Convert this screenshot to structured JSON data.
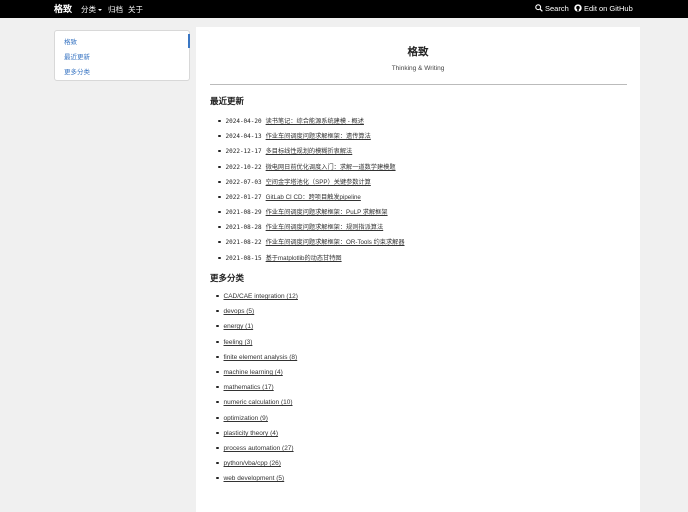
{
  "navbar": {
    "brand": "格致",
    "items": [
      "分类",
      "归档",
      "关于"
    ],
    "search": "Search",
    "github": "Edit on GitHub"
  },
  "sidebar": {
    "items": [
      "格致",
      "最近更新",
      "更多分类"
    ]
  },
  "header": {
    "title": "格致",
    "subtitle": "Thinking & Writing"
  },
  "recent": {
    "heading": "最近更新",
    "posts": [
      {
        "date": "2024-04-20",
        "title": "读书笔记：综合能源系统建模 - 概述"
      },
      {
        "date": "2024-04-13",
        "title": "作业车间调度问题求解框架：遗传算法"
      },
      {
        "date": "2022-12-17",
        "title": "多目标线性规划的模糊折衷解法"
      },
      {
        "date": "2022-10-22",
        "title": "微电网日前优化调度入门：求解一道数学建模题"
      },
      {
        "date": "2022-07-03",
        "title": "空间金字塔池化（SPP）关键参数计算"
      },
      {
        "date": "2022-01-27",
        "title": "GitLab CI CD：跨项目触发pipeline"
      },
      {
        "date": "2021-08-29",
        "title": "作业车间调度问题求解框架：PuLP 求解框架"
      },
      {
        "date": "2021-08-28",
        "title": "作业车间调度问题求解框架：规则指派算法"
      },
      {
        "date": "2021-08-22",
        "title": "作业车间调度问题求解框架：OR-Tools 约束求解器"
      },
      {
        "date": "2021-08-15",
        "title": "基于matplotlib的动态甘特图"
      }
    ]
  },
  "categories": {
    "heading": "更多分类",
    "items": [
      "CAD/CAE integration (12)",
      "devops (5)",
      "energy (1)",
      "feeling (3)",
      "finite element analysis (8)",
      "machine learning (4)",
      "mathematics (17)",
      "numeric calculation (10)",
      "optimization (9)",
      "plasticity theory (4)",
      "process automation (27)",
      "python/vba/cpp (26)",
      "web development (5)"
    ]
  }
}
